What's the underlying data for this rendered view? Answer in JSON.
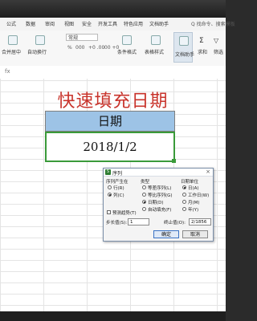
{
  "ribbon_tabs": [
    "公式",
    "数据",
    "审阅",
    "视图",
    "安全",
    "开发工具",
    "特色应用",
    "文档助手"
  ],
  "ribbon_search": "Q 找命令、搜索模板",
  "ribbon": {
    "merge_label": "合并居中",
    "wrap_label": "自动换行",
    "number_format": "常规",
    "cond_format": "条件格式",
    "table_style": "表格样式",
    "doc_assistant": "文档助手",
    "sum": "求和",
    "filter": "筛选",
    "percent": "%",
    "thousands": "000",
    "inc_dec": "+0 .00",
    "dec_inc": ".00 +0"
  },
  "formula_bar": {
    "fx": "fx"
  },
  "sheet": {
    "title": "快速填充日期",
    "header": "日期",
    "date_value": "2018/1/2"
  },
  "dialog": {
    "title": "序列",
    "close": "×",
    "series_in_label": "序列产生在",
    "rows": "行(R)",
    "columns": "列(C)",
    "type_label": "类型",
    "linear": "等差序列(L)",
    "growth": "等比序列(G)",
    "date": "日期(D)",
    "autofill": "自动填充(F)",
    "date_unit_label": "日期单位",
    "day": "日(A)",
    "weekday": "工作日(W)",
    "month": "月(M)",
    "year": "年(Y)",
    "trend": "预测趋势(T)",
    "step_label": "步长值(S):",
    "step_value": "1",
    "stop_label": "终止值(O):",
    "stop_value": "2/1856",
    "ok": "确定",
    "cancel": "取消"
  }
}
